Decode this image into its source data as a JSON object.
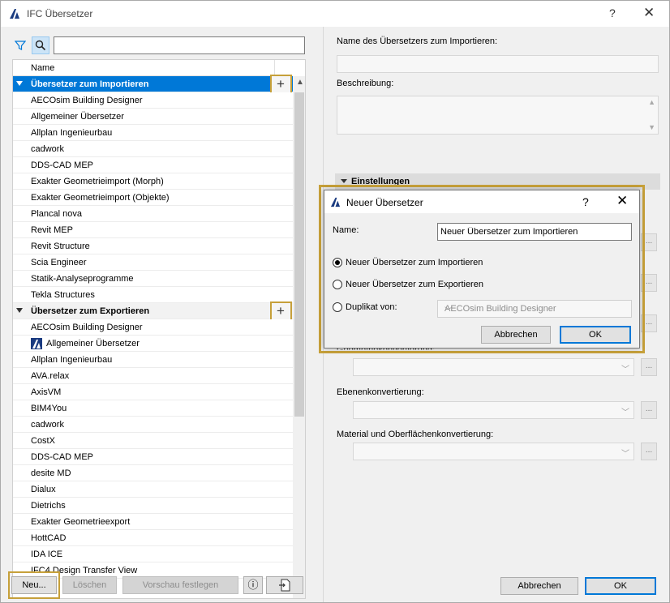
{
  "window": {
    "title": "IFC Übersetzer",
    "help": "?",
    "close": "✕"
  },
  "search": {
    "value": "",
    "placeholder": ""
  },
  "list": {
    "header": "Name",
    "rows": [
      {
        "label": "Übersetzer zum Importieren",
        "group": true,
        "selected": true
      },
      {
        "label": "AECOsim Building Designer"
      },
      {
        "label": "Allgemeiner Übersetzer"
      },
      {
        "label": "Allplan Ingenieurbau"
      },
      {
        "label": "cadwork"
      },
      {
        "label": "DDS-CAD MEP"
      },
      {
        "label": "Exakter Geometrieimport (Morph)"
      },
      {
        "label": "Exakter Geometrieimport (Objekte)"
      },
      {
        "label": "Plancal nova"
      },
      {
        "label": "Revit MEP"
      },
      {
        "label": "Revit Structure"
      },
      {
        "label": "Scia Engineer"
      },
      {
        "label": "Statik-Analyseprogramme"
      },
      {
        "label": "Tekla Structures"
      },
      {
        "label": "Übersetzer zum Exportieren",
        "group": true
      },
      {
        "label": "AECOsim Building Designer"
      },
      {
        "label": "Allgemeiner Übersetzer",
        "icon": true
      },
      {
        "label": "Allplan Ingenieurbau"
      },
      {
        "label": "AVA.relax"
      },
      {
        "label": "AxisVM"
      },
      {
        "label": "BIM4You"
      },
      {
        "label": "cadwork"
      },
      {
        "label": "CostX"
      },
      {
        "label": "DDS-CAD MEP"
      },
      {
        "label": "desite MD"
      },
      {
        "label": "Dialux"
      },
      {
        "label": "Dietrichs"
      },
      {
        "label": "Exakter Geometrieexport"
      },
      {
        "label": "HottCAD"
      },
      {
        "label": "IDA ICE"
      },
      {
        "label": "IFC4 Design Transfer View"
      }
    ],
    "plus": "+"
  },
  "bottom_left": {
    "new": "Neu...",
    "delete": "Löschen",
    "preview": "Vorschau festlegen",
    "info": "ⓘ"
  },
  "right": {
    "name_label": "Name des Übersetzers zum Importieren:",
    "description_label": "Beschreibung:",
    "settings_header": "Einstellungen",
    "obscured_label": "Geometriekonvertierung:",
    "layer_label": "Ebenenkonvertierung:",
    "material_label": "Material und Oberflächenkonvertierung:",
    "dots": "...",
    "cancel": "Abbrechen",
    "ok": "OK"
  },
  "dialog": {
    "title": "Neuer Übersetzer",
    "help": "?",
    "close": "✕",
    "name_label": "Name:",
    "name_value": "Neuer Übersetzer zum Importieren",
    "radio_import": "Neuer Übersetzer zum Importieren",
    "radio_export": "Neuer Übersetzer zum Exportieren",
    "radio_duplicate": "Duplikat von:",
    "duplicate_value": "AECOsim Building Designer",
    "cancel": "Abbrechen",
    "ok": "OK"
  },
  "colors": {
    "selection": "#0078d7",
    "highlight": "#c6a03a"
  }
}
